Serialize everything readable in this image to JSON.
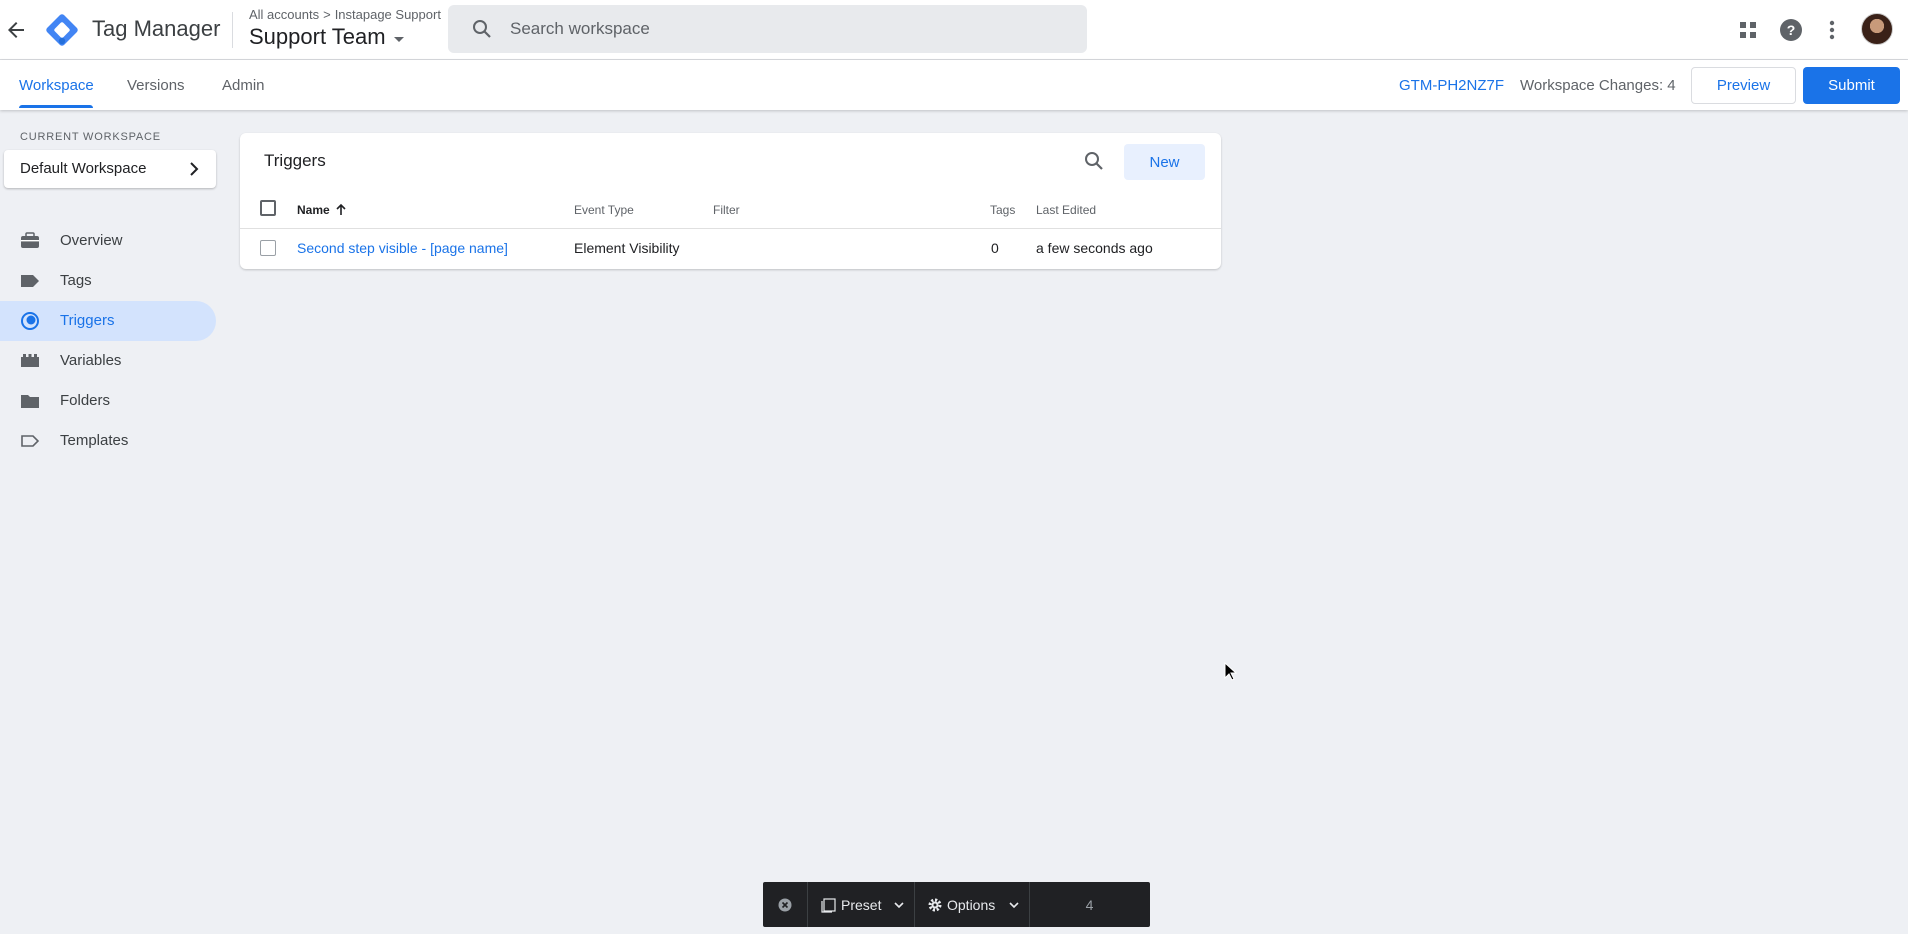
{
  "header": {
    "product_name": "Tag Manager",
    "breadcrumb": {
      "all_accounts": "All accounts",
      "separator": ">",
      "account": "Instapage Support"
    },
    "container_name": "Support Team",
    "search_placeholder": "Search workspace"
  },
  "tabs": [
    {
      "label": "Workspace",
      "active": true
    },
    {
      "label": "Versions",
      "active": false
    },
    {
      "label": "Admin",
      "active": false
    }
  ],
  "toolbar": {
    "container_id": "GTM-PH2NZ7F",
    "workspace_changes": "Workspace Changes: 4",
    "preview_label": "Preview",
    "submit_label": "Submit"
  },
  "sidebar": {
    "current_workspace_label": "CURRENT WORKSPACE",
    "workspace_name": "Default Workspace",
    "items": [
      {
        "label": "Overview",
        "icon": "briefcase-icon",
        "active": false
      },
      {
        "label": "Tags",
        "icon": "tag-icon",
        "active": false
      },
      {
        "label": "Triggers",
        "icon": "trigger-icon",
        "active": true
      },
      {
        "label": "Variables",
        "icon": "variables-icon",
        "active": false
      },
      {
        "label": "Folders",
        "icon": "folder-icon",
        "active": false
      },
      {
        "label": "Templates",
        "icon": "template-icon",
        "active": false
      }
    ]
  },
  "triggers": {
    "title": "Triggers",
    "new_label": "New",
    "columns": {
      "name": "Name",
      "event_type": "Event Type",
      "filter": "Filter",
      "tags": "Tags",
      "last_edited": "Last Edited"
    },
    "rows": [
      {
        "name": "Second step visible - [page name]",
        "event_type": "Element Visibility",
        "filter": "",
        "tags": "0",
        "last_edited": "a few seconds ago"
      }
    ]
  },
  "float_toolbar": {
    "preset_label": "Preset",
    "options_label": "Options",
    "count": "4"
  },
  "colors": {
    "accent": "#1a73e8",
    "active_nav_bg": "#d3e3fd",
    "background": "#eef0f4"
  }
}
